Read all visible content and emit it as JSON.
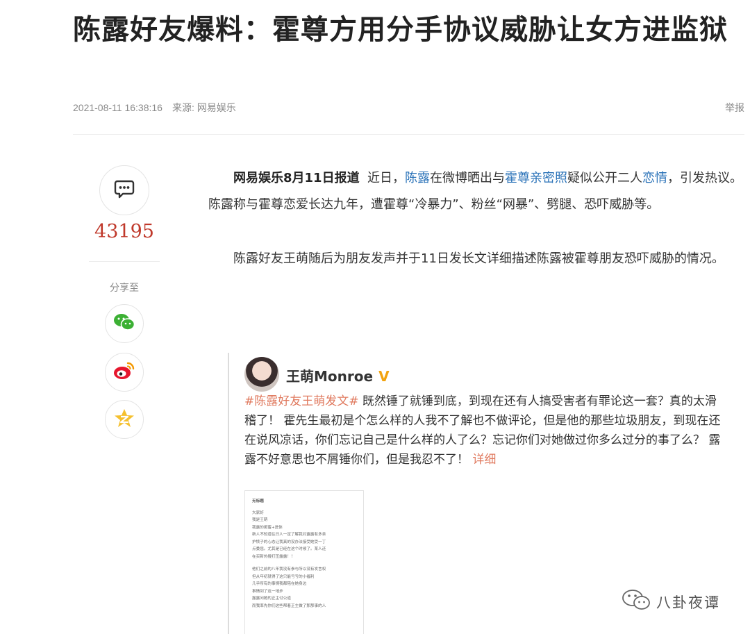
{
  "article": {
    "title": "陈露好友爆料：霍尊方用分手协议威胁让女方进监狱",
    "date": "2021-08-11 16:38:16",
    "source": "来源: 网易娱乐",
    "report": "举报",
    "p1": {
      "source": "网易娱乐8月11日报道",
      "t1": "近日，",
      "link1": "陈露",
      "t2": "在微博晒出与",
      "link2": "霍尊亲密照",
      "t3": "疑似公开二人",
      "link3": "恋情",
      "t4": "，引发热议。陈露称与霍尊恋爱长达九年，遭霍尊“冷暴力”、粉丝“网暴”、劈腿、恐吓威胁等。"
    },
    "p2": "陈露好友王萌随后为朋友发声并于11日发长文详细描述陈露被霍尊朋友恐吓威胁的情况。"
  },
  "sidebar": {
    "comment_count": "43195",
    "share_label": "分享至",
    "icons": [
      "comment-icon",
      "wechat-icon",
      "weibo-icon",
      "qzone-icon"
    ]
  },
  "embed": {
    "username": "王萌Monroe",
    "badge": "V",
    "hashtag": "#陈露好友王萌发文#",
    "text": " 既然锤了就锤到底，到现在还有人搞受害者有罪论这一套？真的太滑稽了！ 霍先生最初是个怎么样的人我不了解也不做评论，但是他的那些垃圾朋友，到现在还在说风凉话，你们忘记自己是什么样的人了么？忘记你们对她做过你多么过分的事了么？ 露露不好意思也不屑锤你们，但是我忍不了！ ",
    "more": "详细",
    "doc": {
      "title": "无标题",
      "lines_a": [
        "大家好",
        "我是王萌",
        "我露的闺蜜+进体",
        "新人不知道往日人一定了解我对露露有多亲",
        "护犊子的心态让我真的没办法接受她受一丁",
        "点委屈。尤其是已经在这个时候了。某人还",
        "在买新热搜打压露露！！"
      ],
      "lines_b": [
        "他们之前的八年我没有参与所以没有发言权",
        "但从年初就得了这只能亏亏的小福利",
        "几乎所有的事情我都陪在她身边",
        "事情到了这一地步",
        "露露问她的正主讨公道",
        "而我率先你们这些帮着正主做了那那事的人"
      ]
    }
  },
  "watermark": {
    "text": "八卦夜谭",
    "icon": "wechat-logo-icon"
  },
  "colors": {
    "link": "#2a72b8",
    "count": "#c0392b",
    "hashtag": "#e07a5f",
    "verified": "#f2a30f"
  }
}
